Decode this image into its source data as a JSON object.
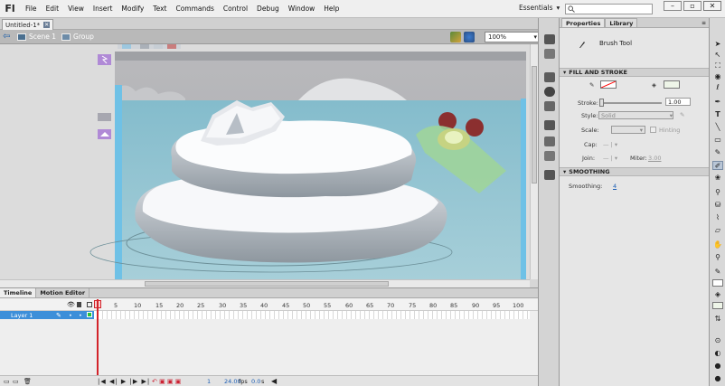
{
  "app": {
    "logo": "Fl",
    "workspace": "Essentials",
    "search_placeholder": ""
  },
  "menu": [
    "File",
    "Edit",
    "View",
    "Insert",
    "Modify",
    "Text",
    "Commands",
    "Control",
    "Debug",
    "Window",
    "Help"
  ],
  "document": {
    "tab_title": "Untitled-1*",
    "scene": "Scene 1",
    "group": "Group",
    "zoom": "100%"
  },
  "timeline": {
    "tabs": [
      "Timeline",
      "Motion Editor"
    ],
    "layer_name": "Layer 1",
    "frame_ticks": [
      "1",
      "5",
      "10",
      "15",
      "20",
      "25",
      "30",
      "35",
      "40",
      "45",
      "50",
      "55",
      "60",
      "65",
      "70",
      "75",
      "80",
      "85",
      "90",
      "95",
      "100"
    ],
    "current_frame": "1",
    "fps": "24.00",
    "fps_unit": "fps",
    "time": "0.0",
    "time_unit": "s"
  },
  "properties": {
    "tabs": [
      "Properties",
      "Library"
    ],
    "tool_name": "Brush Tool",
    "fill_stroke_title": "FILL AND STROKE",
    "stroke_label": "Stroke:",
    "stroke_value": "1.00",
    "style_label": "Style:",
    "style_value": "Solid",
    "scale_label": "Scale:",
    "hinting_label": "Hinting",
    "cap_label": "Cap:",
    "join_label": "Join:",
    "miter_label": "Miter:",
    "miter_value": "3.00",
    "smoothing_title": "SMOOTHING",
    "smoothing_label": "Smoothing:",
    "smoothing_value": "4",
    "stroke_color": "#ff0000",
    "fill_color": "#eef5e8"
  },
  "colors": {
    "accent": "#3d8fd9",
    "playhead": "#d3232a"
  }
}
